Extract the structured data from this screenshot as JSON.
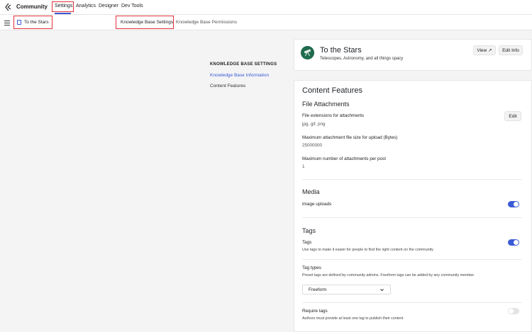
{
  "topbar": {
    "app_title": "Community",
    "nav": [
      "Settings",
      "Analytics",
      "Designer",
      "Dev Tools"
    ]
  },
  "subbar": {
    "breadcrumb": "To the Stars",
    "tabs": [
      "Knowledge Base Settings",
      "Knowledge Base Permissions"
    ]
  },
  "sidebar": {
    "heading": "KNOWLEDGE BASE SETTINGS",
    "items": [
      "Knowledge Base Information",
      "Content Features"
    ]
  },
  "header_card": {
    "name": "To the Stars",
    "description": "Telescopes, Astronomy, and all things spacy",
    "view_button": "View ↗",
    "edit_info_button": "Edit Info"
  },
  "content": {
    "title": "Content Features",
    "file_attachments": {
      "heading": "File Attachments",
      "edit_button": "Edit",
      "extensions_label": "File extensions for attachments",
      "extensions_value": "jpg, gif, png",
      "max_size_label": "Maximum attachment file size for upload (Bytes)",
      "max_size_value": "25000000",
      "max_count_label": "Maximum number of attachments per post",
      "max_count_value": "1"
    },
    "media": {
      "heading": "Media",
      "image_uploads_label": "Image uploads",
      "image_uploads_on": true
    },
    "tags": {
      "heading": "Tags",
      "tags_label": "Tags",
      "tags_help": "Use tags to make it easier for people to find the right content on the community",
      "tags_on": true,
      "tag_types_label": "Tag types",
      "tag_types_help": "Preset tags are defined by community admins. Freeform tags can be added by any community member.",
      "tag_types_value": "Freeform",
      "require_label": "Require tags",
      "require_help": "Authors must provide at least one tag to publish their content",
      "require_on": false
    }
  },
  "colors": {
    "accent": "#3b5bd6",
    "highlight": "#e0323a",
    "avatar": "#1f6b4e"
  }
}
